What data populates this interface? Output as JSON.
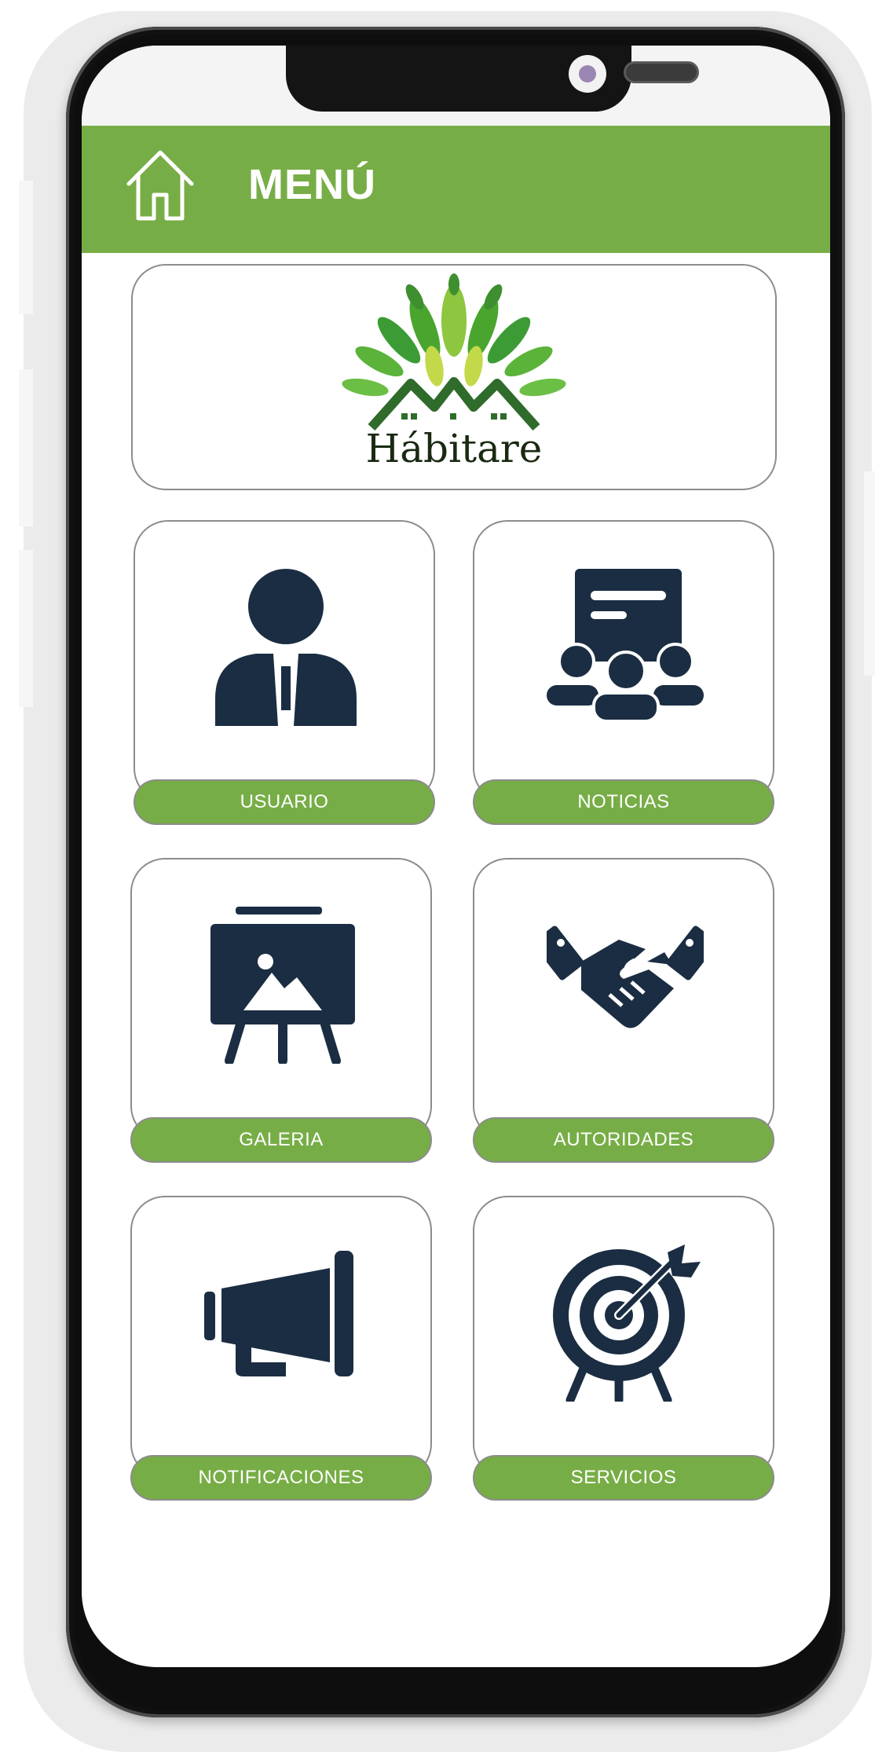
{
  "header": {
    "title": "MENÚ",
    "home_icon": "home-icon"
  },
  "logo": {
    "text": "Hábitare"
  },
  "tiles": [
    {
      "label": "USUARIO",
      "icon": "user-icon"
    },
    {
      "label": "NOTICIAS",
      "icon": "news-presentation-icon"
    },
    {
      "label": "GALERIA",
      "icon": "gallery-easel-icon"
    },
    {
      "label": "AUTORIDADES",
      "icon": "handshake-icon"
    },
    {
      "label": "NOTIFICACIONES",
      "icon": "megaphone-icon"
    },
    {
      "label": "SERVICIOS",
      "icon": "target-icon"
    }
  ],
  "colors": {
    "accent": "#77ad46",
    "icon": "#1b2d42",
    "border": "#8c8c8c"
  }
}
